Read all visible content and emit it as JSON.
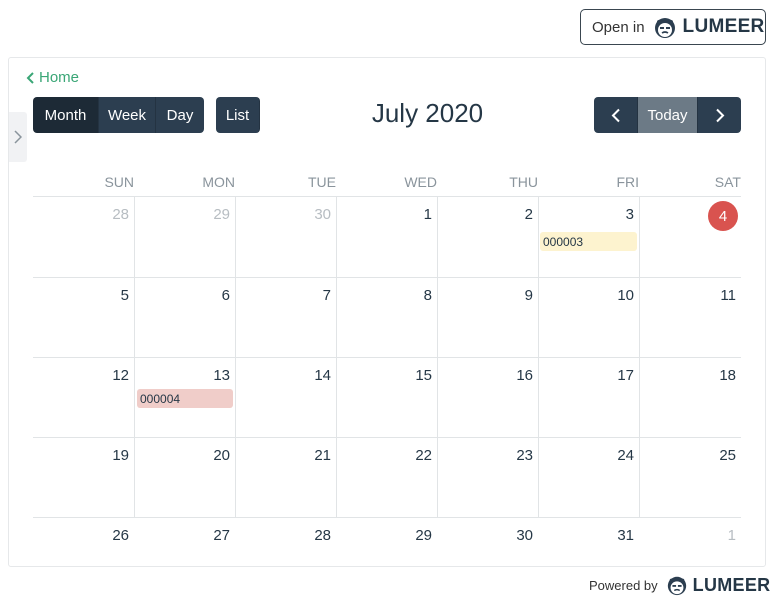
{
  "header": {
    "open_in_label": "Open in",
    "brand": "LUMEER"
  },
  "nav": {
    "home_label": "Home"
  },
  "toolbar": {
    "views": [
      "Month",
      "Week",
      "Day"
    ],
    "active_view": "Month",
    "list_label": "List",
    "today_label": "Today"
  },
  "calendar": {
    "title": "July 2020",
    "weekdays": [
      "SUN",
      "MON",
      "TUE",
      "WED",
      "THU",
      "FRI",
      "SAT"
    ],
    "weeks": [
      [
        "28",
        "29",
        "30",
        "1",
        "2",
        "3",
        "4"
      ],
      [
        "5",
        "6",
        "7",
        "8",
        "9",
        "10",
        "11"
      ],
      [
        "12",
        "13",
        "14",
        "15",
        "16",
        "17",
        "18"
      ],
      [
        "19",
        "20",
        "21",
        "22",
        "23",
        "24",
        "25"
      ],
      [
        "26",
        "27",
        "28",
        "29",
        "30",
        "31",
        "1"
      ]
    ],
    "today": "4",
    "events": [
      {
        "label": "000003",
        "color": "#fdf3cf"
      },
      {
        "label": "000004",
        "color": "#f0cdc9"
      }
    ]
  },
  "footer": {
    "powered_by": "Powered by",
    "brand": "LUMEER"
  },
  "colors": {
    "toolbar_button": "#2c3e50",
    "today_badge": "#d9534f",
    "link": "#3aa676"
  }
}
